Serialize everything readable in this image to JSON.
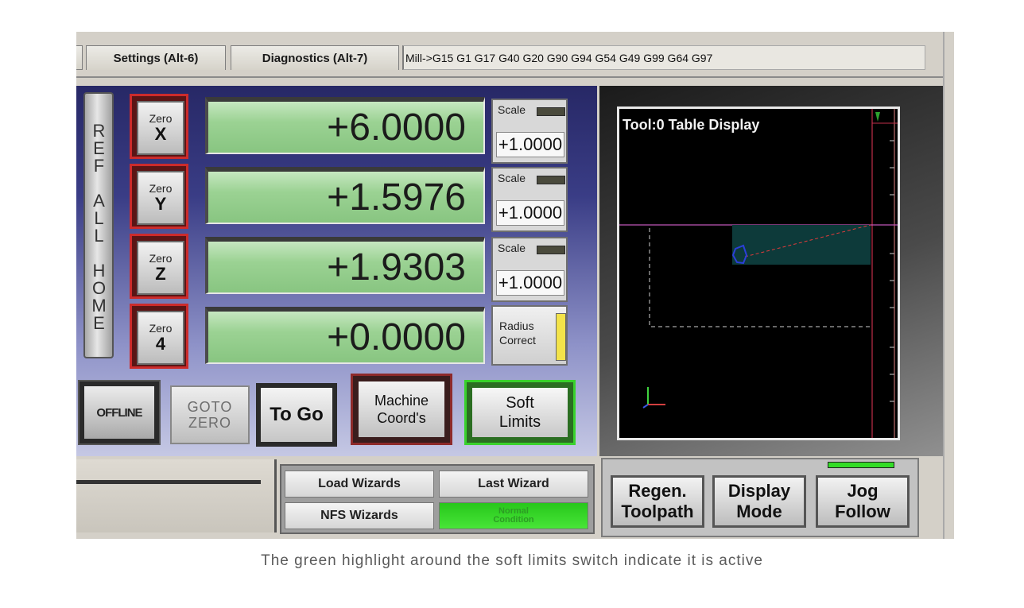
{
  "tabs": [
    {
      "label": "Settings (Alt-6)"
    },
    {
      "label": "Diagnostics (Alt-7)"
    }
  ],
  "modal_line": "Mill->G15  G1 G17 G40 G20 G90 G94 G54 G49 G99 G64 G97",
  "ref_all_home": "REF ALL HOME",
  "axes": [
    {
      "zero_top": "Zero",
      "zero_axis": "X",
      "dro": "+6.0000",
      "scale_label": "Scale",
      "scale_value": "+1.0000"
    },
    {
      "zero_top": "Zero",
      "zero_axis": "Y",
      "dro": "+1.5976",
      "scale_label": "Scale",
      "scale_value": "+1.0000"
    },
    {
      "zero_top": "Zero",
      "zero_axis": "Z",
      "dro": "+1.9303",
      "scale_label": "Scale",
      "scale_value": "+1.0000"
    },
    {
      "zero_top": "Zero",
      "zero_axis": "4",
      "dro": "+0.0000"
    }
  ],
  "radius_correct": {
    "line1": "Radius",
    "line2": "Correct",
    "indicator_color": "#f3e34a"
  },
  "buttons": {
    "offline": "OFFLINE",
    "goto_line1": "GOTO",
    "goto_line2": "ZERO",
    "to_go": "To Go",
    "machine_line1": "Machine",
    "machine_line2": "Coord's",
    "soft_line1": "Soft",
    "soft_line2": "Limits"
  },
  "display": {
    "title": "Tool:0    Table Display"
  },
  "wizards": {
    "load": "Load Wizards",
    "last": "Last Wizard",
    "nfs": "NFS Wizards",
    "normal_line1": "Normal",
    "normal_line2": "Condition"
  },
  "right_buttons": {
    "regen_line1": "Regen.",
    "regen_line2": "Toolpath",
    "display_line1": "Display",
    "display_line2": "Mode",
    "jog_line1": "Jog",
    "jog_line2": "Follow"
  },
  "colors": {
    "soft_limits_active": "#39d22c",
    "jog_follow_led": "#33dd27",
    "dro_green": "#9bd293"
  },
  "caption": "The green highlight around the soft limits switch indicate it is active"
}
